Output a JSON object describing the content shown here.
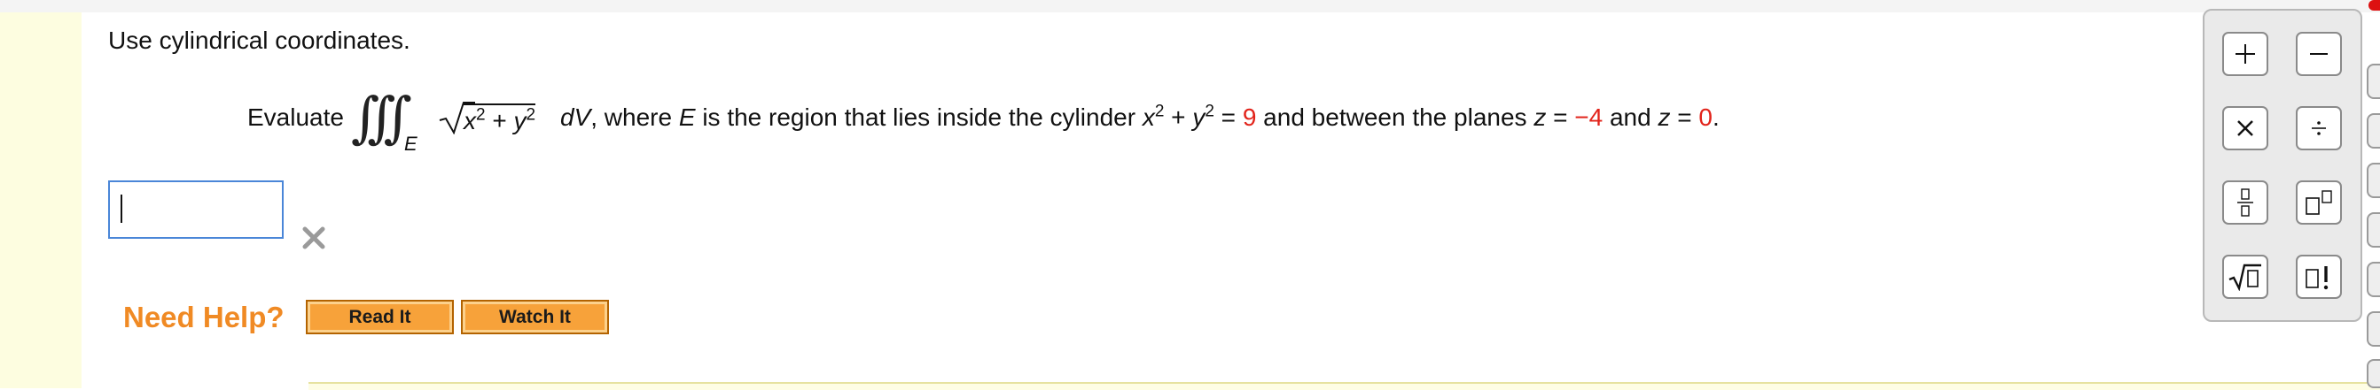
{
  "problem": {
    "instruction": "Use cylindrical coordinates.",
    "evaluate_label": "Evaluate",
    "integral_region": "E",
    "integrand": "x2 + y2 dV",
    "statement": "where E is the region that lies inside the cylinder x2 + y2 = 9 and between the planes z = −4 and z = 0.",
    "cylinder_radius_squared": "9",
    "z_lower": "−4",
    "z_upper": "0"
  },
  "answer": {
    "value": "",
    "status_icon": "incorrect-x-icon"
  },
  "help": {
    "label": "Need Help?",
    "read_it": "Read It",
    "watch_it": "Watch It"
  },
  "keypad": {
    "keys": [
      {
        "name": "plus",
        "symbol": "+"
      },
      {
        "name": "minus",
        "symbol": "−"
      },
      {
        "name": "times",
        "symbol": "×"
      },
      {
        "name": "divide",
        "symbol": "÷"
      },
      {
        "name": "fraction",
        "symbol": "fraction-template"
      },
      {
        "name": "power",
        "symbol": "exponent-template"
      },
      {
        "name": "sqrt",
        "symbol": "√"
      },
      {
        "name": "factorial",
        "symbol": "!"
      }
    ]
  },
  "colors": {
    "accent_orange": "#f08a24",
    "button_orange": "#f7a23a",
    "value_red": "#e2231a",
    "input_border_blue": "#4a86d8",
    "sidebar_yellow": "#fdfde0"
  }
}
